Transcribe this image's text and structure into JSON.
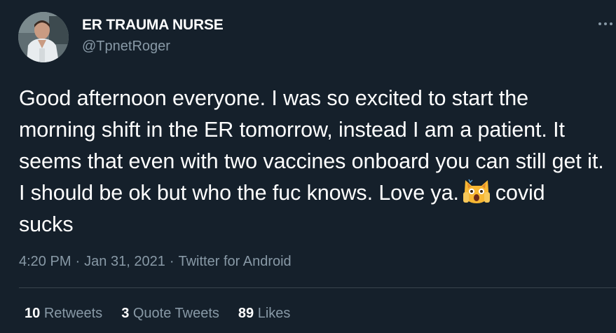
{
  "tweet": {
    "author": {
      "display_name": "ER TRAUMA NURSE",
      "handle": "@TpnetRoger",
      "avatar_icon": "profile-photo"
    },
    "more_icon": "more-options-icon",
    "text_before_emoji": "Good afternoon everyone. I was so excited to start the morning shift in the ER tomorrow, instead I am a patient. It seems that even with two vaccines onboard you can still get it. I should be ok but who the fuc knows. Love ya.",
    "emoji": "weary-cat-face-emoji",
    "text_after_emoji": "covid sucks",
    "meta": {
      "time": "4:20 PM",
      "separator": "·",
      "date": "Jan 31, 2021",
      "source": "Twitter for Android"
    },
    "stats": [
      {
        "count": "10",
        "label": "Retweets"
      },
      {
        "count": "3",
        "label": "Quote Tweets"
      },
      {
        "count": "89",
        "label": "Likes"
      }
    ]
  },
  "colors": {
    "background": "#15202b",
    "primary_text": "#ffffff",
    "secondary_text": "#8899a6",
    "divider": "#38444d"
  }
}
